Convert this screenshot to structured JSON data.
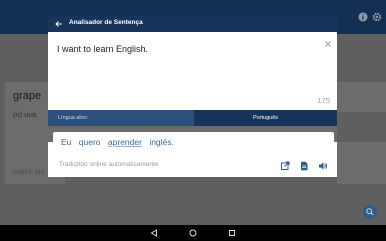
{
  "background": {
    "card_word": "grape",
    "card_def_pos": "(n)",
    "card_def": "uva",
    "card_button": "SABER MA"
  },
  "dialog": {
    "title": "Analisador de Sentença",
    "source_text": "I want to learn English.",
    "char_count": "175",
    "target_language_label": "Língua alvo:",
    "target_language_value": "Português",
    "translation_words": [
      "Eu",
      "quero",
      "aprender",
      "inglés."
    ],
    "auto_translated_label": "Traduzido online automaticamente"
  },
  "colors": {
    "header": "#17345a",
    "accent": "#2c4f7c",
    "translation_text": "#3a6aa2"
  },
  "icons": {
    "back": "arrow-left-icon",
    "clear": "close-icon",
    "open_external": "open-in-new-icon",
    "document": "document-icon",
    "speaker": "volume-icon",
    "info": "info-icon",
    "settings": "gear-icon"
  }
}
